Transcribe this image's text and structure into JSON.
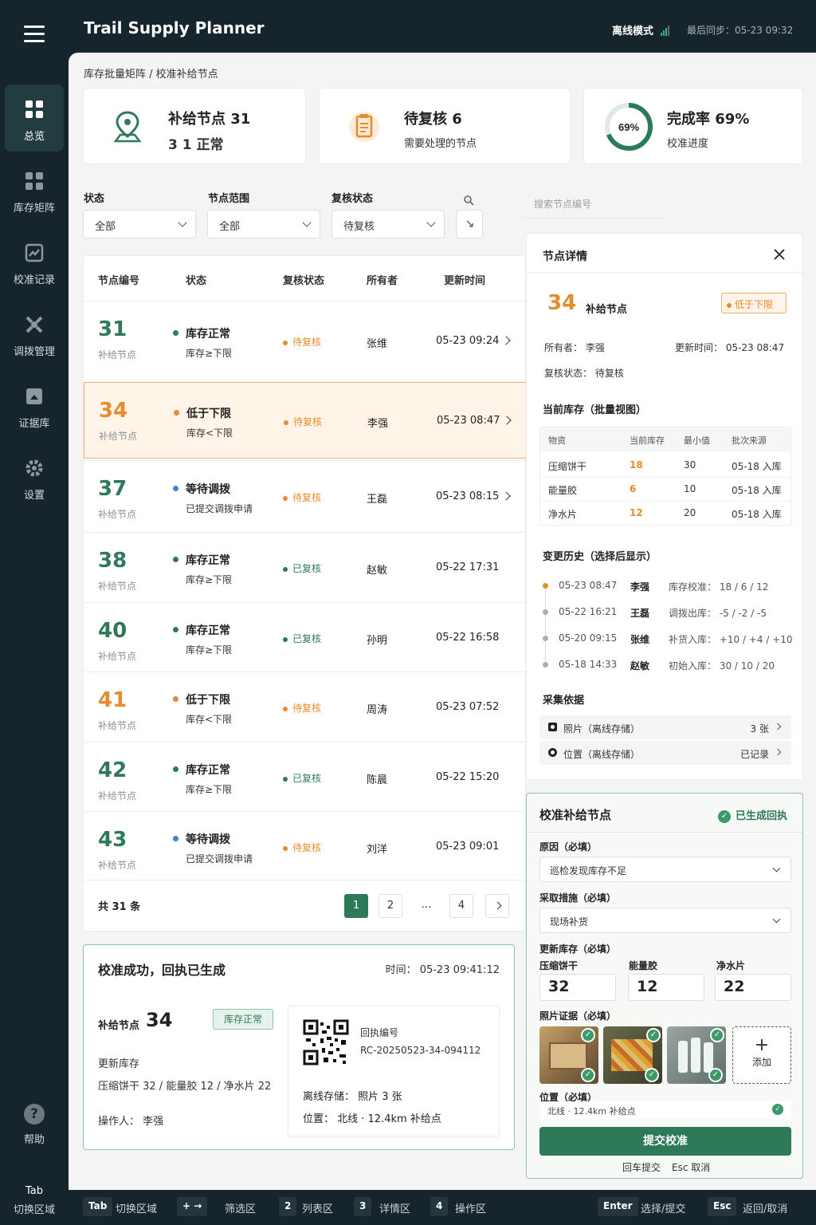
{
  "app": {
    "title": "Trail Supply Planner",
    "offline_label": "离线模式",
    "last_sync": "最后同步：05-23 09:32"
  },
  "sidebar": {
    "items": [
      {
        "label": "总览",
        "icon": "dashboard-icon",
        "active": true
      },
      {
        "label": "库存矩阵",
        "icon": "grid-icon",
        "active": false
      },
      {
        "label": "校准记录",
        "icon": "calibration-icon",
        "active": false
      },
      {
        "label": "调拨管理",
        "icon": "transfer-icon",
        "active": false
      },
      {
        "label": "证据库",
        "icon": "evidence-icon",
        "active": false
      },
      {
        "label": "设置",
        "icon": "gear-icon",
        "active": false
      }
    ],
    "help_label": "帮助",
    "tab_key": "Tab",
    "tab_hint": "切换区域"
  },
  "breadcrumb": "库存批量矩阵 / 校准补给节点",
  "kpis": {
    "nodes": {
      "title": "补给节点 31",
      "sub": "3 1 正常"
    },
    "pending": {
      "title": "待复核 6",
      "sub": "需要处理的节点"
    },
    "completion": {
      "title": "完成率 69%",
      "sub": "校准进度",
      "ring_text": "69%",
      "percent": 69
    }
  },
  "filters": {
    "status": {
      "label": "状态",
      "value": "全部"
    },
    "range": {
      "label": "节点范围",
      "value": "全部"
    },
    "review": {
      "label": "复核状态",
      "value": "待复核"
    },
    "search_placeholder": "搜索节点编号"
  },
  "table": {
    "headers": [
      "节点编号",
      "状态",
      "复核状态",
      "所有者",
      "更新时间"
    ],
    "node_label": "补给节点",
    "rows": [
      {
        "id": "31",
        "status": "库存正常",
        "sub": "库存≥下限",
        "review": "待复核",
        "owner": "张维",
        "time": "05-23 09:24"
      },
      {
        "id": "34",
        "status": "低于下限",
        "sub": "库存<下限",
        "review": "待复核",
        "owner": "李强",
        "time": "05-23 08:47"
      },
      {
        "id": "37",
        "status": "等待调拨",
        "sub": "已提交调拨申请",
        "review": "待复核",
        "owner": "王磊",
        "time": "05-23 08:15"
      },
      {
        "id": "38",
        "status": "库存正常",
        "sub": "库存≥下限",
        "review": "已复核",
        "owner": "赵敏",
        "time": "05-22 17:31"
      },
      {
        "id": "40",
        "status": "库存正常",
        "sub": "库存≥下限",
        "review": "已复核",
        "owner": "孙明",
        "time": "05-22 16:58"
      },
      {
        "id": "41",
        "status": "低于下限",
        "sub": "库存<下限",
        "review": "待复核",
        "owner": "周涛",
        "time": "05-23 07:52"
      },
      {
        "id": "42",
        "status": "库存正常",
        "sub": "库存≥下限",
        "review": "已复核",
        "owner": "陈晨",
        "time": "05-22 15:20"
      },
      {
        "id": "43",
        "status": "等待调拨",
        "sub": "已提交调拨申请",
        "review": "待复核",
        "owner": "刘洋",
        "time": "05-23 09:01"
      }
    ],
    "total": "共 31 条",
    "pages": [
      "1",
      "2",
      "…",
      "4"
    ]
  },
  "receipt": {
    "title": "校准成功，回执已生成",
    "time": "时间：  05-23 09:41:12",
    "node_label": "补给节点",
    "node_id": "34",
    "badge": "库存正常",
    "update_label": "更新库存",
    "update_value": "压缩饼干 32 / 能量胶 12 / 净水片 22",
    "operator": "操作人：  李强",
    "receipt_label": "回执编号",
    "receipt_no": "RC-20250523-34-094112",
    "offline_store": "离线存储：  照片 3 张",
    "location": "位置：  北线 · 12.4km 补给点"
  },
  "detail": {
    "title": "节点详情",
    "node_id": "34",
    "node_label": "补给节点",
    "badge": "低于下限",
    "owner": "所有者：      李强",
    "updated": "更新时间：  05-23 08:47",
    "review": "复核状态：   待复核",
    "inventory_title": "当前库存（批量视图）",
    "inv_headers": [
      "物资",
      "当前库存",
      "最小值",
      "批次来源"
    ],
    "inv_rows": [
      {
        "item": "压缩饼干",
        "current": "18",
        "min": "30",
        "batch": "05-18 入库"
      },
      {
        "item": "能量胶",
        "current": "6",
        "min": "10",
        "batch": "05-18 入库"
      },
      {
        "item": "净水片",
        "current": "12",
        "min": "20",
        "batch": "05-18 入库"
      }
    ],
    "history_title": "变更历史（选择后显示）",
    "history": [
      {
        "time": "05-23 08:47",
        "who": "李强",
        "what": "库存校准：  18 / 6 / 12"
      },
      {
        "time": "05-22 16:21",
        "who": "王磊",
        "what": "调拨出库：  -5 / -2 / -5"
      },
      {
        "time": "05-20 09:15",
        "who": "张维",
        "what": "补货入库：  +10 / +4 / +10"
      },
      {
        "time": "05-18 14:33",
        "who": "赵敏",
        "what": "初始入库：  30 / 10 / 20"
      }
    ],
    "evidence_title": "采集依据",
    "evidence": [
      {
        "label": "照片（离线存储）",
        "value": "3 张"
      },
      {
        "label": "位置（离线存储）",
        "value": "已记录"
      }
    ]
  },
  "calibrate": {
    "title": "校准补给节点",
    "status": "已生成回执",
    "reason_label": "原因（必填）",
    "reason_value": "巡检发现库存不足",
    "action_label": "采取措施（必填）",
    "action_value": "现场补货",
    "update_label": "更新库存（必填）",
    "items": [
      {
        "name": "压缩饼干",
        "value": "32"
      },
      {
        "name": "能量胶",
        "value": "12"
      },
      {
        "name": "净水片",
        "value": "22"
      }
    ],
    "photo_label": "照片证据（必填）",
    "add_label": "添加",
    "location_label": "位置（必填）",
    "location_value": "北线 · 12.4km 补给点",
    "submit": "提交校准",
    "hint_enter": "回车提交",
    "hint_esc": "Esc 取消"
  },
  "shortcuts": [
    {
      "key": "Tab",
      "label": "切换区域"
    },
    {
      "key": "+ →",
      "label": "筛选区"
    },
    {
      "key": "2",
      "label": "列表区"
    },
    {
      "key": "3",
      "label": "详情区"
    },
    {
      "key": "4",
      "label": "操作区"
    },
    {
      "key": "Enter",
      "label": "选择/提交"
    },
    {
      "key": "Esc",
      "label": "返回/取消"
    }
  ],
  "colors": {
    "accent": "#2e7a58",
    "warning": "#e58c2e",
    "info": "#3b82d6",
    "sidebar": "#16242c"
  }
}
